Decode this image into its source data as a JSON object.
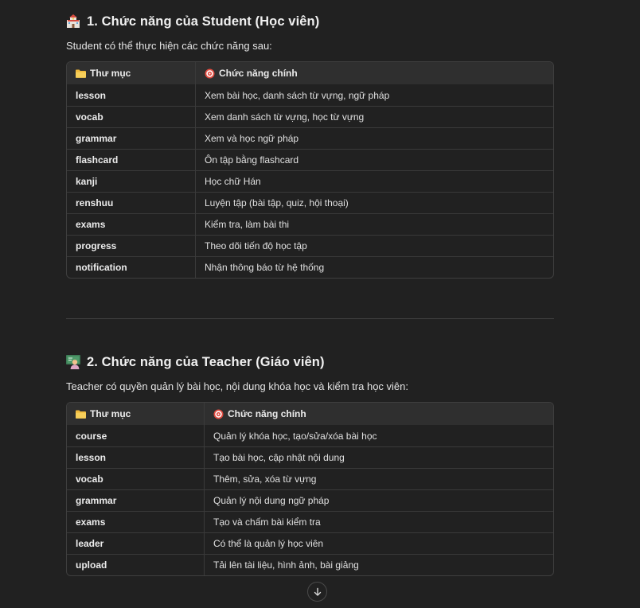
{
  "student": {
    "heading": "1. Chức năng của Student (Học viên)",
    "heading_icon": "school-building-emoji",
    "intro": "Student có thể thực hiện các chức năng sau:",
    "columns": [
      "Thư mục",
      "Chức năng chính"
    ],
    "rows": [
      {
        "folder": "lesson",
        "function": "Xem bài học, danh sách từ vựng, ngữ pháp"
      },
      {
        "folder": "vocab",
        "function": "Xem danh sách từ vựng, học từ vựng"
      },
      {
        "folder": "grammar",
        "function": "Xem và học ngữ pháp"
      },
      {
        "folder": "flashcard",
        "function": "Ôn tập bằng flashcard"
      },
      {
        "folder": "kanji",
        "function": "Học chữ Hán"
      },
      {
        "folder": "renshuu",
        "function": "Luyện tập (bài tập, quiz, hội thoại)"
      },
      {
        "folder": "exams",
        "function": "Kiểm tra, làm bài thi"
      },
      {
        "folder": "progress",
        "function": "Theo dõi tiến độ học tập"
      },
      {
        "folder": "notification",
        "function": "Nhận thông báo từ hệ thống"
      }
    ]
  },
  "teacher": {
    "heading": "2. Chức năng của Teacher (Giáo viên)",
    "heading_icon": "teacher-emoji",
    "intro": "Teacher có quyền quản lý bài học, nội dung khóa học và kiểm tra học viên:",
    "columns": [
      "Thư mục",
      "Chức năng chính"
    ],
    "rows": [
      {
        "folder": "course",
        "function": "Quản lý khóa học, tạo/sửa/xóa bài học"
      },
      {
        "folder": "lesson",
        "function": "Tạo bài học, cập nhật nội dung"
      },
      {
        "folder": "vocab",
        "function": "Thêm, sửa, xóa từ vựng"
      },
      {
        "folder": "grammar",
        "function": "Quản lý nội dung ngữ pháp"
      },
      {
        "folder": "exams",
        "function": "Tạo và chấm bài kiểm tra"
      },
      {
        "folder": "leader",
        "function": "Có thể là quản lý học viên"
      },
      {
        "folder": "upload",
        "function": "Tải lên tài liệu, hình ảnh, bài giảng"
      }
    ]
  },
  "icons": {
    "folder": "folder-icon",
    "target": "target-icon",
    "scroll": "arrow-down-icon"
  },
  "colors": {
    "background": "#212121",
    "table_header": "#2f2f2f",
    "border": "#3f3f3f"
  }
}
